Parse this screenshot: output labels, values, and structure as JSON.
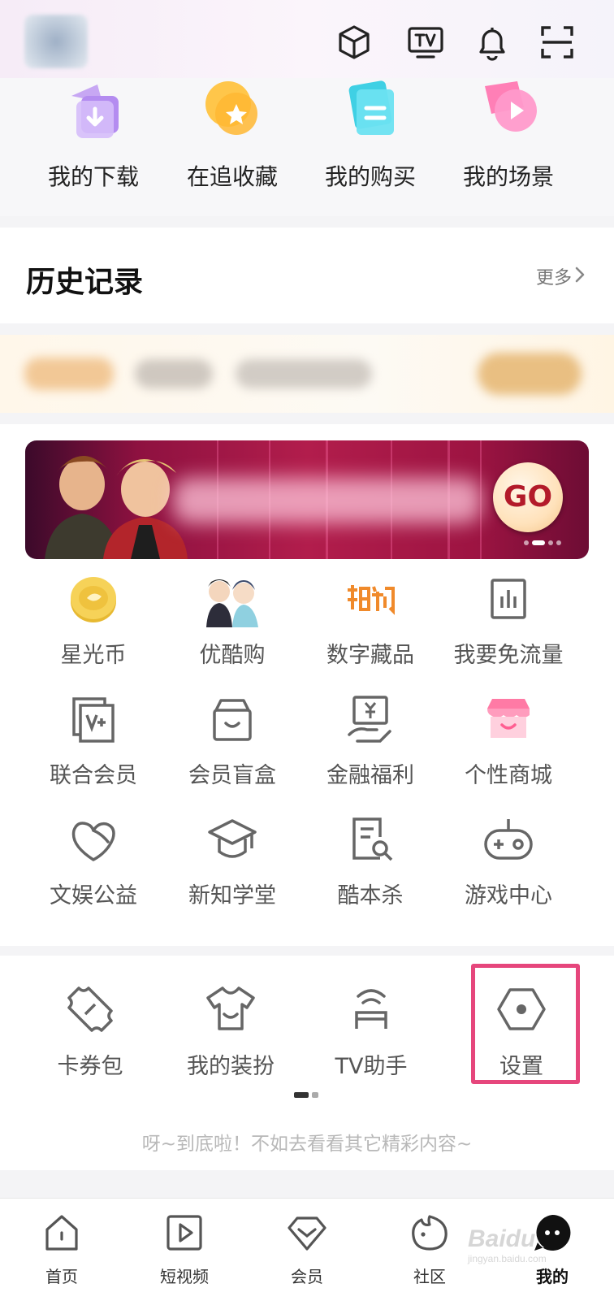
{
  "quick_actions": [
    {
      "label": "我的下载",
      "icon": "download-icon"
    },
    {
      "label": "在追收藏",
      "icon": "star-icon"
    },
    {
      "label": "我的购买",
      "icon": "purchase-icon"
    },
    {
      "label": "我的场景",
      "icon": "play-scene-icon"
    }
  ],
  "top_icons": [
    "cube-icon",
    "tv-icon",
    "bell-icon",
    "scan-icon"
  ],
  "history": {
    "title": "历史记录",
    "more": "更多"
  },
  "banner": {
    "button": "GO",
    "page_count": 4,
    "active_page": 1
  },
  "services": [
    {
      "label": "星光币",
      "icon": "star-coin-icon"
    },
    {
      "label": "优酷购",
      "icon": "youku-shop-icon"
    },
    {
      "label": "数字藏品",
      "icon": "digital-collectible-icon"
    },
    {
      "label": "我要免流量",
      "icon": "free-data-icon"
    },
    {
      "label": "联合会员",
      "icon": "joint-member-icon"
    },
    {
      "label": "会员盲盒",
      "icon": "blind-box-icon"
    },
    {
      "label": "金融福利",
      "icon": "finance-icon"
    },
    {
      "label": "个性商城",
      "icon": "store-icon"
    },
    {
      "label": "文娱公益",
      "icon": "charity-icon"
    },
    {
      "label": "新知学堂",
      "icon": "graduation-cap-icon"
    },
    {
      "label": "酷本杀",
      "icon": "script-search-icon"
    },
    {
      "label": "游戏中心",
      "icon": "gamepad-icon"
    }
  ],
  "tools": [
    {
      "label": "卡券包",
      "icon": "ticket-icon"
    },
    {
      "label": "我的装扮",
      "icon": "tshirt-icon"
    },
    {
      "label": "TV助手",
      "icon": "tv-assistant-icon"
    },
    {
      "label": "设置",
      "icon": "settings-icon"
    }
  ],
  "bottom_hint": "呀~到底啦！不如去看看其它精彩内容~",
  "tabs": [
    {
      "label": "首页",
      "icon": "home-icon"
    },
    {
      "label": "短视频",
      "icon": "short-video-icon"
    },
    {
      "label": "会员",
      "icon": "member-diamond-icon"
    },
    {
      "label": "社区",
      "icon": "community-icon"
    },
    {
      "label": "我的",
      "icon": "my-chat-icon",
      "active": true
    }
  ],
  "watermark": {
    "brand": "Baidu",
    "sub": "jingyan.baidu.com"
  },
  "colors": {
    "highlight": "#e6467c",
    "text": "#555555",
    "hint": "#b8b8b8"
  }
}
